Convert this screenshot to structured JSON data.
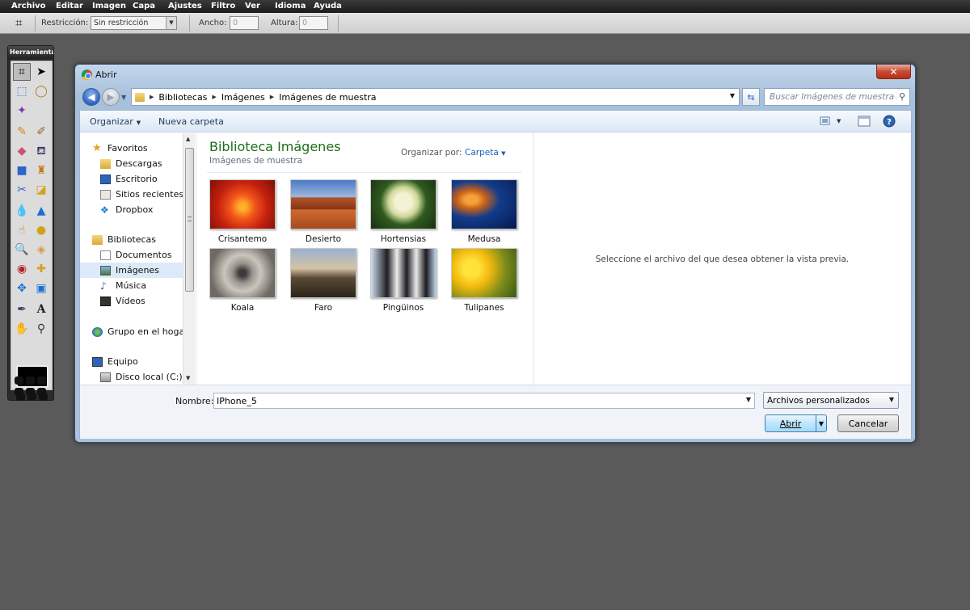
{
  "menubar": {
    "items": [
      "Archivo",
      "Editar",
      "Imagen",
      "Capa",
      "Ajustes",
      "Filtro",
      "Ver",
      "Idioma",
      "Ayuda"
    ]
  },
  "optionsbar": {
    "restriction_label": "Restricción:",
    "restriction_value": "Sin restricción",
    "width_label": "Ancho:",
    "width_value": "0",
    "height_label": "Altura:",
    "height_value": "0"
  },
  "tools_panel": {
    "title": "Herramientas",
    "foreground_color": "#000000"
  },
  "dialog": {
    "title": "Abrir",
    "close_glyph": "✕",
    "breadcrumb": [
      "Bibliotecas",
      "Imágenes",
      "Imágenes de muestra"
    ],
    "search_placeholder": "Buscar Imágenes de muestra",
    "toolbar": {
      "organize": "Organizar",
      "new_folder": "Nueva carpeta"
    },
    "nav": {
      "favorites": "Favoritos",
      "downloads": "Descargas",
      "desktop": "Escritorio",
      "recent": "Sitios recientes",
      "dropbox": "Dropbox",
      "libraries": "Bibliotecas",
      "documents": "Documentos",
      "images": "Imágenes",
      "music": "Música",
      "videos": "Vídeos",
      "homegroup": "Grupo en el hogar",
      "computer": "Equipo",
      "local_disk": "Disco local (C:)"
    },
    "library": {
      "title": "Biblioteca Imágenes",
      "subtitle": "Imágenes de muestra",
      "arrange_label": "Organizar por:",
      "arrange_value": "Carpeta"
    },
    "files": [
      "Crisantemo",
      "Desierto",
      "Hortensias",
      "Medusa",
      "Koala",
      "Faro",
      "Pingüinos",
      "Tulipanes"
    ],
    "preview_message": "Seleccione el archivo del que desea obtener la vista previa.",
    "filename_label": "Nombre:",
    "filename_value": "IPhone_5",
    "filetype_value": "Archivos personalizados",
    "open_button": "Abrir",
    "cancel_button": "Cancelar"
  },
  "colors": {
    "library_title": "#1e6b17",
    "link_blue": "#1d5fba",
    "desktop_bg": "#5a5a5a"
  }
}
